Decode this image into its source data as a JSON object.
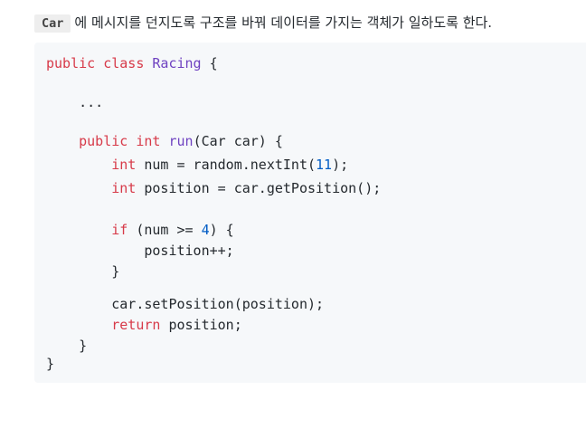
{
  "intro": {
    "code": "Car",
    "text": "에 메시지를 던지도록 구조를 바꿔 데이터를 가지는 객체가 일하도록 한다."
  },
  "code": {
    "lines": [
      [
        {
          "t": "public",
          "c": "kw"
        },
        {
          "t": " "
        },
        {
          "t": "class",
          "c": "kw"
        },
        {
          "t": " "
        },
        {
          "t": "Racing",
          "c": "fn"
        },
        {
          "t": " {"
        }
      ],
      [
        {
          "t": "    ..."
        }
      ],
      [
        {
          "t": "    "
        },
        {
          "t": "public",
          "c": "kw"
        },
        {
          "t": " "
        },
        {
          "t": "int",
          "c": "kw"
        },
        {
          "t": " "
        },
        {
          "t": "run",
          "c": "fn"
        },
        {
          "t": "(Car car) {"
        }
      ],
      [
        {
          "t": "        "
        },
        {
          "t": "int",
          "c": "kw"
        },
        {
          "t": " num = random.nextInt("
        },
        {
          "t": "11",
          "c": "num"
        },
        {
          "t": ");"
        }
      ],
      [
        {
          "t": "        "
        },
        {
          "t": "int",
          "c": "kw"
        },
        {
          "t": " position = car.getPosition();"
        }
      ],
      [
        {
          "t": "        "
        },
        {
          "t": "if",
          "c": "kw"
        },
        {
          "t": " (num >= "
        },
        {
          "t": "4",
          "c": "num"
        },
        {
          "t": ") {"
        }
      ],
      [
        {
          "t": "            position++;"
        }
      ],
      [
        {
          "t": "        }"
        }
      ],
      [
        {
          "t": "        car.setPosition(position);"
        }
      ],
      [
        {
          "t": "        "
        },
        {
          "t": "return",
          "c": "kw"
        },
        {
          "t": " position;"
        }
      ],
      [
        {
          "t": "    }"
        }
      ],
      [
        {
          "t": "}"
        }
      ]
    ]
  }
}
